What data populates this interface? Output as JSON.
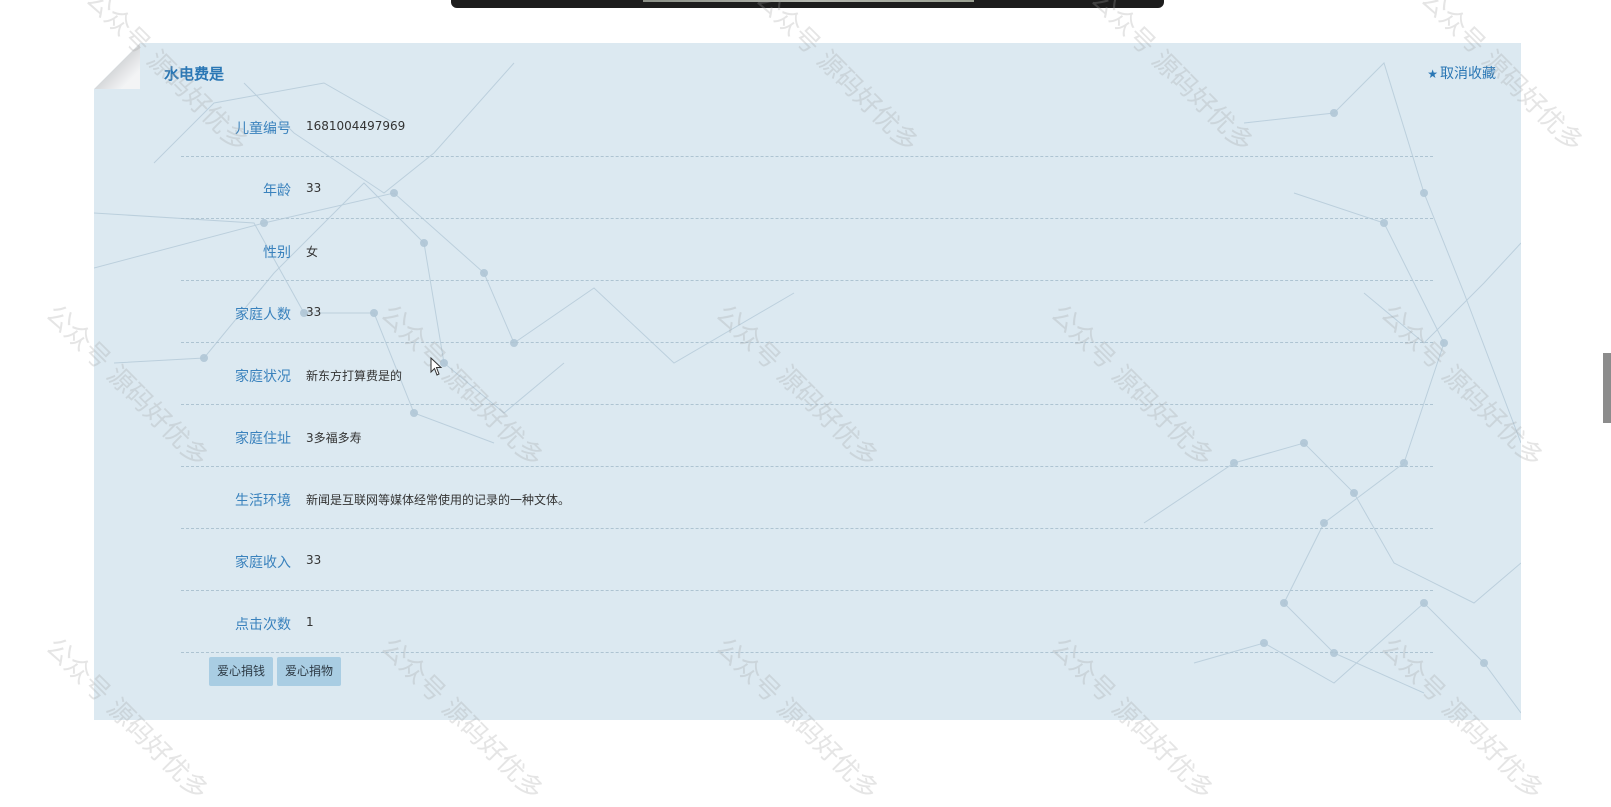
{
  "card": {
    "title": "水电费是",
    "fav_label": "取消收藏",
    "fav_icon": "star-icon"
  },
  "fields": [
    {
      "label": "儿童编号",
      "value": "1681004497969"
    },
    {
      "label": "年龄",
      "value": "33"
    },
    {
      "label": "性别",
      "value": "女"
    },
    {
      "label": "家庭人数",
      "value": "33"
    },
    {
      "label": "家庭状况",
      "value": "新东方打算费是的"
    },
    {
      "label": "家庭住址",
      "value": "3多福多寿"
    },
    {
      "label": "生活环境",
      "value": "新闻是互联网等媒体经常使用的记录的一种文体。"
    },
    {
      "label": "家庭收入",
      "value": "33"
    },
    {
      "label": "点击次数",
      "value": "1"
    }
  ],
  "buttons": {
    "donate_money": "爱心捐钱",
    "donate_goods": "爱心捐物"
  },
  "watermark": "公众号 源码好优多",
  "colors": {
    "accent": "#2a77b5",
    "label": "#3a82bd",
    "card_bg": "#dce9f1",
    "button_bg": "#a9cde3"
  }
}
